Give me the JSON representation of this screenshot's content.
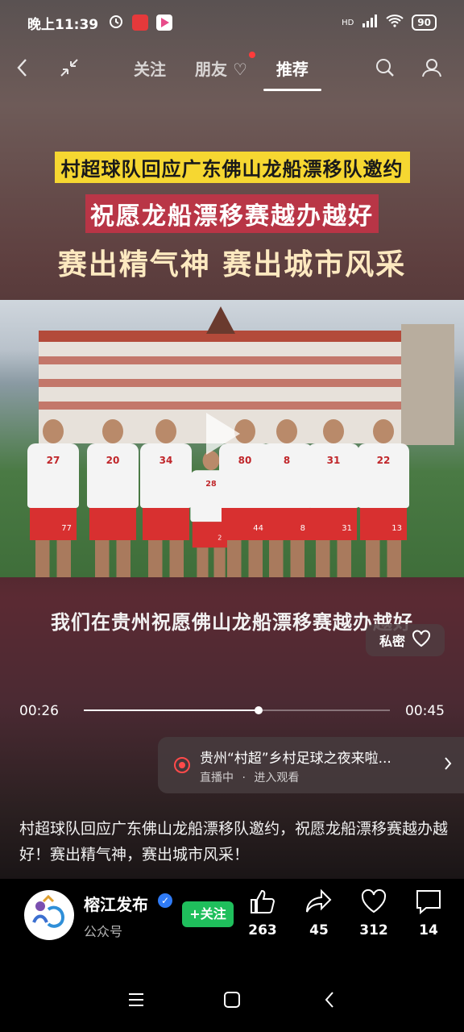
{
  "status_bar": {
    "time": "晚上11:39",
    "network": "HD",
    "battery": "90"
  },
  "nav": {
    "tabs": [
      {
        "label": "关注"
      },
      {
        "label": "朋友"
      },
      {
        "label": "推荐"
      }
    ],
    "active_tab": "推荐"
  },
  "video": {
    "title_line1": "村超球队回应广东佛山龙船漂移队邀约",
    "title_line2": "祝愿龙船漂移赛越办越好",
    "title_line3": "赛出精气神 赛出城市风采",
    "subtitle": "我们在贵州祝愿佛山龙船漂移赛越办越好",
    "jersey_numbers": [
      "27",
      "20",
      "34",
      "28",
      "80",
      "8",
      "31",
      "22"
    ],
    "shorts_numbers": [
      "77",
      "",
      "",
      "28",
      "44",
      "8",
      "31",
      "13"
    ],
    "current_time": "00:26",
    "duration": "00:45",
    "progress_fraction": 0.57
  },
  "private_message": {
    "label": "私密"
  },
  "live": {
    "title": "贵州“村超”乡村足球之夜来啦...",
    "status": "直播中",
    "separator": "·",
    "action": "进入观看"
  },
  "description": "村超球队回应广东佛山龙船漂移队邀约，祝愿龙船漂移赛越办越好！赛出精气神，赛出城市风采！",
  "account": {
    "name": "榕江发布",
    "type": "公众号",
    "follow_label": "+关注"
  },
  "actions": {
    "likes": "263",
    "shares": "45",
    "favorites": "312",
    "comments": "14"
  },
  "colors": {
    "follow_green": "#1fbf5c",
    "title_yellow": "#f6d731",
    "live_red": "#ff4a4a"
  }
}
